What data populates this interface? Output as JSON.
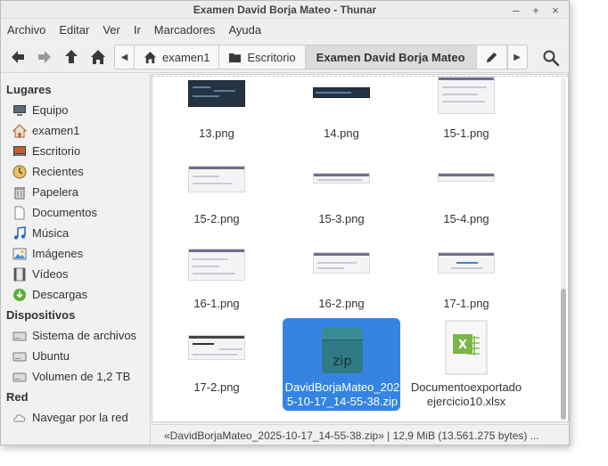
{
  "window": {
    "title": "Examen David Borja Mateo - Thunar"
  },
  "menubar": {
    "items": [
      "Archivo",
      "Editar",
      "Ver",
      "Ir",
      "Marcadores",
      "Ayuda"
    ]
  },
  "toolbar": {
    "breadcrumbs": [
      "examen1",
      "Escritorio",
      "Examen David Borja Mateo"
    ]
  },
  "sidebar": {
    "sections": [
      {
        "header": "Lugares",
        "items": [
          {
            "label": "Equipo",
            "icon": "computer-icon"
          },
          {
            "label": "examen1",
            "icon": "home-icon"
          },
          {
            "label": "Escritorio",
            "icon": "desktop-icon"
          },
          {
            "label": "Recientes",
            "icon": "recent-icon"
          },
          {
            "label": "Papelera",
            "icon": "trash-icon"
          },
          {
            "label": "Documentos",
            "icon": "document-icon"
          },
          {
            "label": "Música",
            "icon": "music-icon"
          },
          {
            "label": "Imágenes",
            "icon": "images-icon"
          },
          {
            "label": "Vídeos",
            "icon": "video-icon"
          },
          {
            "label": "Descargas",
            "icon": "download-icon"
          }
        ]
      },
      {
        "header": "Dispositivos",
        "items": [
          {
            "label": "Sistema de archivos",
            "icon": "drive-icon"
          },
          {
            "label": "Ubuntu",
            "icon": "drive-icon"
          },
          {
            "label": "Volumen de 1,2 TB",
            "icon": "drive-icon"
          }
        ]
      },
      {
        "header": "Red",
        "items": [
          {
            "label": "Navegar por la red",
            "icon": "network-icon"
          }
        ]
      }
    ]
  },
  "files": [
    {
      "name": "13.png",
      "type": "image",
      "style": "dark"
    },
    {
      "name": "14.png",
      "type": "image",
      "style": "dark"
    },
    {
      "name": "15-1.png",
      "type": "image",
      "style": "light"
    },
    {
      "name": "15-2.png",
      "type": "image",
      "style": "light"
    },
    {
      "name": "15-3.png",
      "type": "image",
      "style": "light"
    },
    {
      "name": "15-4.png",
      "type": "image",
      "style": "light"
    },
    {
      "name": "16-1.png",
      "type": "image",
      "style": "light"
    },
    {
      "name": "16-2.png",
      "type": "image",
      "style": "light"
    },
    {
      "name": "17-1.png",
      "type": "image",
      "style": "light"
    },
    {
      "name": "17-2.png",
      "type": "image",
      "style": "light"
    },
    {
      "name_line1": "DavidBorjaMateo_202",
      "name_line2": "5-10-17_14-55-38.zip",
      "type": "zip",
      "selected": true,
      "icon_text": "zip"
    },
    {
      "name_line1": "Documentoexportado",
      "name_line2": "ejercicio10.xlsx",
      "type": "xlsx",
      "icon_text": "X"
    }
  ],
  "statusbar": {
    "text": "«DavidBorjaMateo_2025-10-17_14-55-38.zip» | 12,9 MiB (13.561.275 bytes) ..."
  },
  "colors": {
    "selection": "#3584e4",
    "zip": "#2f7a84",
    "xlsx": "#7ab648"
  }
}
